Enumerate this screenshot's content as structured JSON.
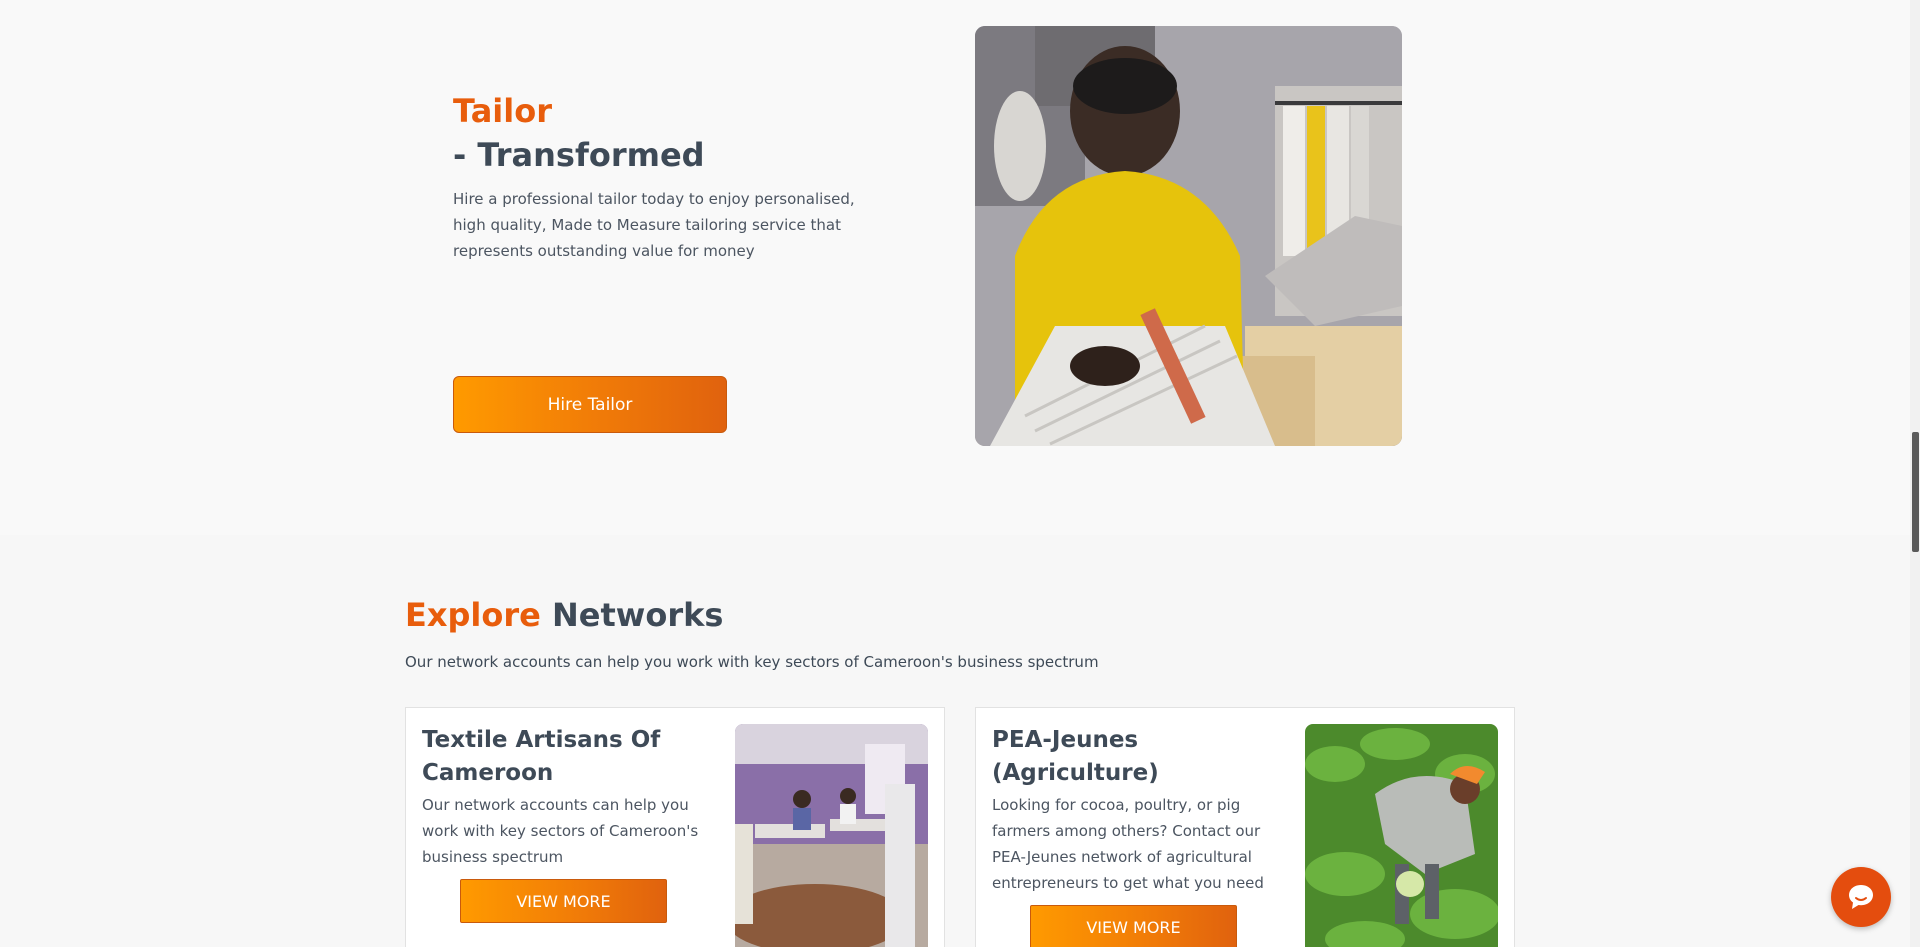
{
  "hero": {
    "title_accent": "Tailor",
    "title_main": "- Transformed",
    "description": "Hire a professional tailor today to enjoy personalised, high quality, Made to Measure tailoring service that represents outstanding value for money",
    "button_label": "Hire Tailor",
    "photo_icon": "tailor-photo"
  },
  "networks": {
    "title_accent": "Explore",
    "title_rest": "Networks",
    "subtitle": "Our network accounts can help you work with key sectors of Cameroon's business spectrum",
    "cards": [
      {
        "title": "Textile Artisans Of Cameroon",
        "description": "Our network accounts can help you work with key sectors of Cameroon's business spectrum",
        "button_label": "VIEW MORE"
      },
      {
        "title": "PEA-Jeunes (Agriculture)",
        "description": "Looking for cocoa, poultry, or pig farmers among others? Contact our PEA-Jeunes network of agricultural entrepreneurs to get what you need",
        "button_label": "VIEW MORE"
      }
    ]
  },
  "chat": {
    "icon": "chat-bubble-icon"
  },
  "colors": {
    "accent": "#e85d0c",
    "button_start": "#ff9a00",
    "button_end": "#e0620e",
    "heading": "#3e4a57"
  }
}
